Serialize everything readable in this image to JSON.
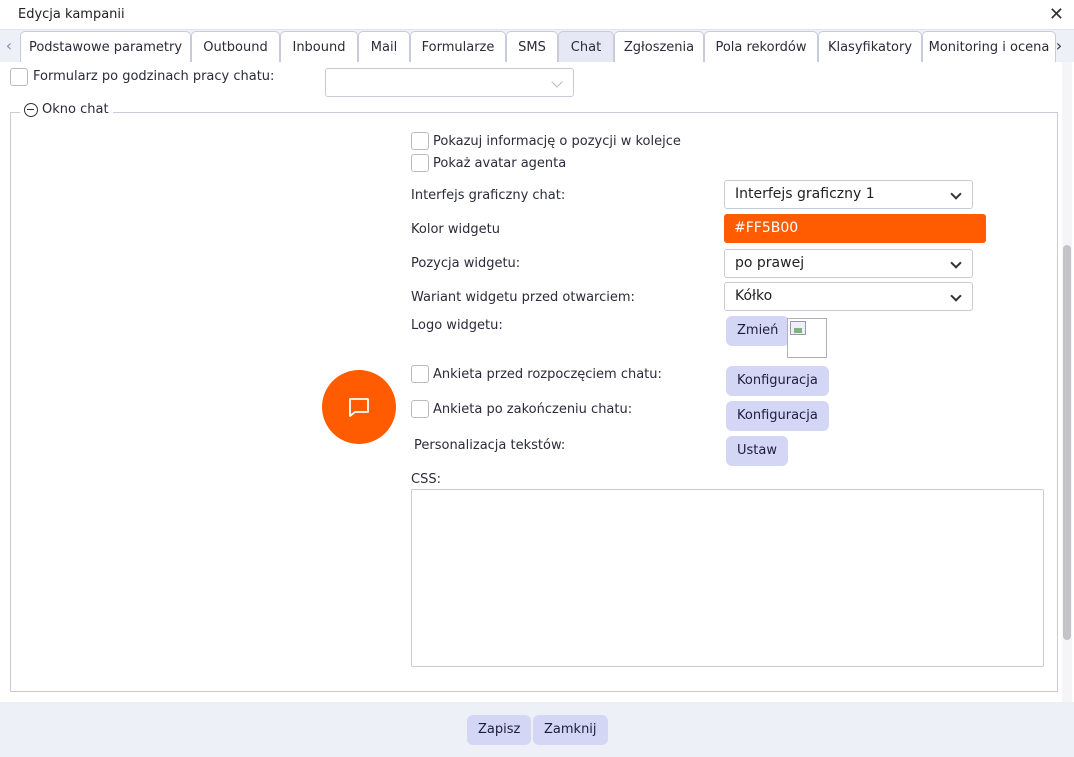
{
  "window": {
    "title": "Edycja kampanii"
  },
  "tabs": [
    {
      "label": "Podstawowe parametry"
    },
    {
      "label": "Outbound"
    },
    {
      "label": "Inbound"
    },
    {
      "label": "Mail"
    },
    {
      "label": "Formularze"
    },
    {
      "label": "SMS"
    },
    {
      "label": "Chat",
      "active": true
    },
    {
      "label": "Zgłoszenia"
    },
    {
      "label": "Pola rekordów"
    },
    {
      "label": "Klasyfikatory"
    },
    {
      "label": "Monitoring i ocena"
    }
  ],
  "after_hours_form": {
    "label": "Formularz po godzinach pracy chatu:",
    "checked": false,
    "value": ""
  },
  "chat_window": {
    "legend": "Okno chat",
    "show_queue_info": {
      "label": "Pokazuj informację o pozycji w kolejce",
      "checked": false
    },
    "show_agent_avatar": {
      "label": "Pokaż avatar agenta",
      "checked": false
    },
    "gui": {
      "label": "Interfejs graficzny chat:",
      "value": "Interfejs graficzny 1"
    },
    "widget_color": {
      "label": "Kolor widgetu",
      "value": "#FF5B00"
    },
    "widget_position": {
      "label": "Pozycja widgetu:",
      "value": "po prawej"
    },
    "widget_variant": {
      "label": "Wariant widgetu przed otwarciem:",
      "value": "Kółko"
    },
    "widget_logo": {
      "label": "Logo widgetu:",
      "button": "Zmień"
    },
    "pre_chat_survey": {
      "label": "Ankieta przed rozpoczęciem chatu:",
      "checked": false,
      "button": "Konfiguracja"
    },
    "post_chat_survey": {
      "label": "Ankieta po zakończeniu chatu:",
      "checked": false,
      "button": "Konfiguracja"
    },
    "text_personalization": {
      "label": "Personalizacja tekstów:",
      "button": "Ustaw"
    },
    "css": {
      "label": "CSS:",
      "value": ""
    },
    "preview_icon": "chat-bubble-icon"
  },
  "footer": {
    "save": "Zapisz",
    "close": "Zamknij"
  },
  "colors": {
    "accent": "#FF5B00",
    "button_bg": "#D4D6F5",
    "tabbar_bg": "#EEF0F8"
  }
}
